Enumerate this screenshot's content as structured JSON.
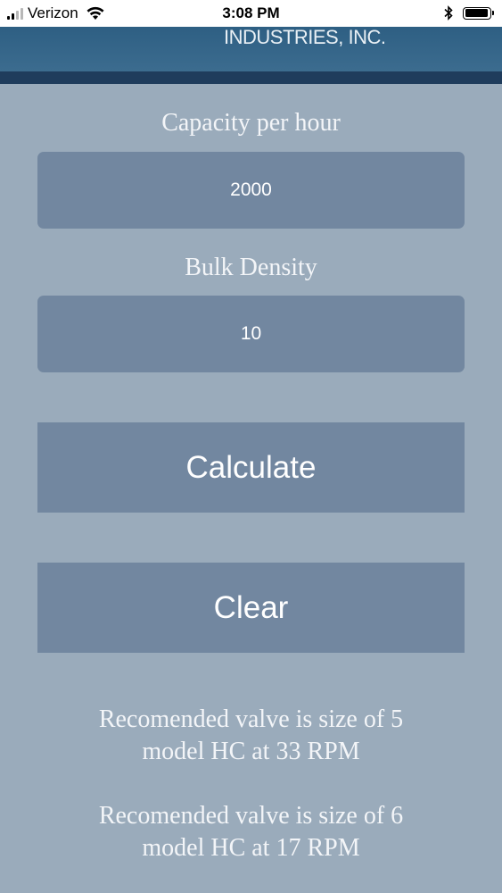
{
  "status_bar": {
    "carrier": "Verizon",
    "time": "3:08 PM",
    "signal_bars": 4,
    "signal_active": 2,
    "battery_level": 0.95
  },
  "header": {
    "brand_text": "INDUSTRIES, INC."
  },
  "form": {
    "capacity_label": "Capacity per hour",
    "capacity_value": "2000",
    "density_label": "Bulk Density",
    "density_value": "10",
    "calculate_label": "Calculate",
    "clear_label": "Clear"
  },
  "results": [
    {
      "line1": "Recomended valve is size of 5",
      "line2": "model HC at 33 RPM"
    },
    {
      "line1": "Recomended valve is size of 6",
      "line2": "model HC at 17 RPM"
    }
  ],
  "colors": {
    "background": "#9aabbb",
    "header": "#2e5f83",
    "control": "#7287a0"
  },
  "icons": [
    "signal-icon",
    "wifi-icon",
    "bluetooth-icon",
    "battery-icon"
  ]
}
